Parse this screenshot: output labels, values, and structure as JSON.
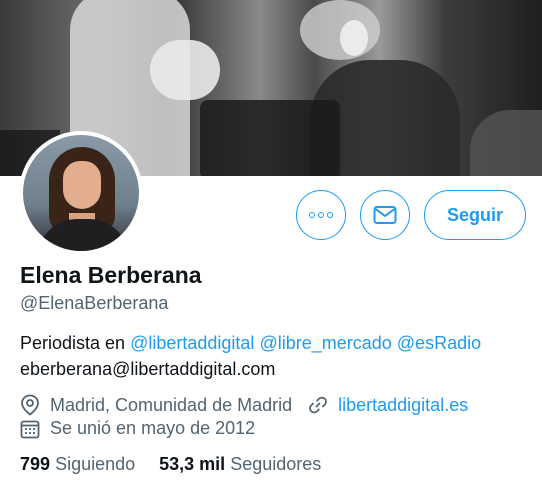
{
  "profile": {
    "name": "Elena Berberana",
    "handle": "@ElenaBerberana",
    "bio": {
      "prefix": "Periodista en ",
      "mentions": [
        "@libertaddigital",
        "@libre_mercado",
        "@esRadio"
      ],
      "email_line": "eberberana@libertaddigital.com"
    },
    "location": "Madrid, Comunidad de Madrid",
    "website": "libertaddigital.es",
    "joined": "Se unió en mayo de 2012"
  },
  "actions": {
    "follow_label": "Seguir"
  },
  "stats": {
    "following_count": "799",
    "following_label": "Siguiendo",
    "followers_count": "53,3 mil",
    "followers_label": "Seguidores"
  },
  "icons": {
    "more": "more-options-icon",
    "message": "envelope-icon",
    "location": "location-pin-icon",
    "link": "link-icon",
    "calendar": "calendar-icon"
  },
  "colors": {
    "accent": "#1d9bf0",
    "text_primary": "#0f1419",
    "text_secondary": "#536471",
    "background": "#ffffff"
  }
}
